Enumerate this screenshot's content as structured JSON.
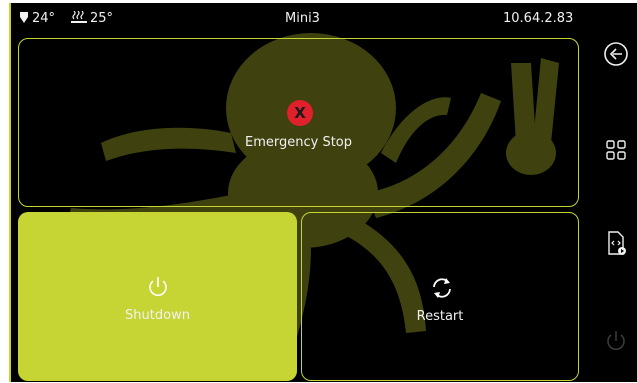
{
  "statusbar": {
    "nozzle_temp": "24°",
    "bed_temp": "25°",
    "printer_name": "Mini3",
    "ip_address": "10.64.2.83"
  },
  "actions": {
    "emergency_stop": "Emergency Stop",
    "shutdown": "Shutdown",
    "restart": "Restart"
  },
  "sidebar": {
    "items": [
      "back-icon",
      "grid-icon",
      "gcode-file-icon",
      "power-icon"
    ]
  },
  "colors": {
    "accent": "#c6d534",
    "background": "#000000",
    "stop": "#e0202a",
    "text": "#f1f1f1"
  }
}
